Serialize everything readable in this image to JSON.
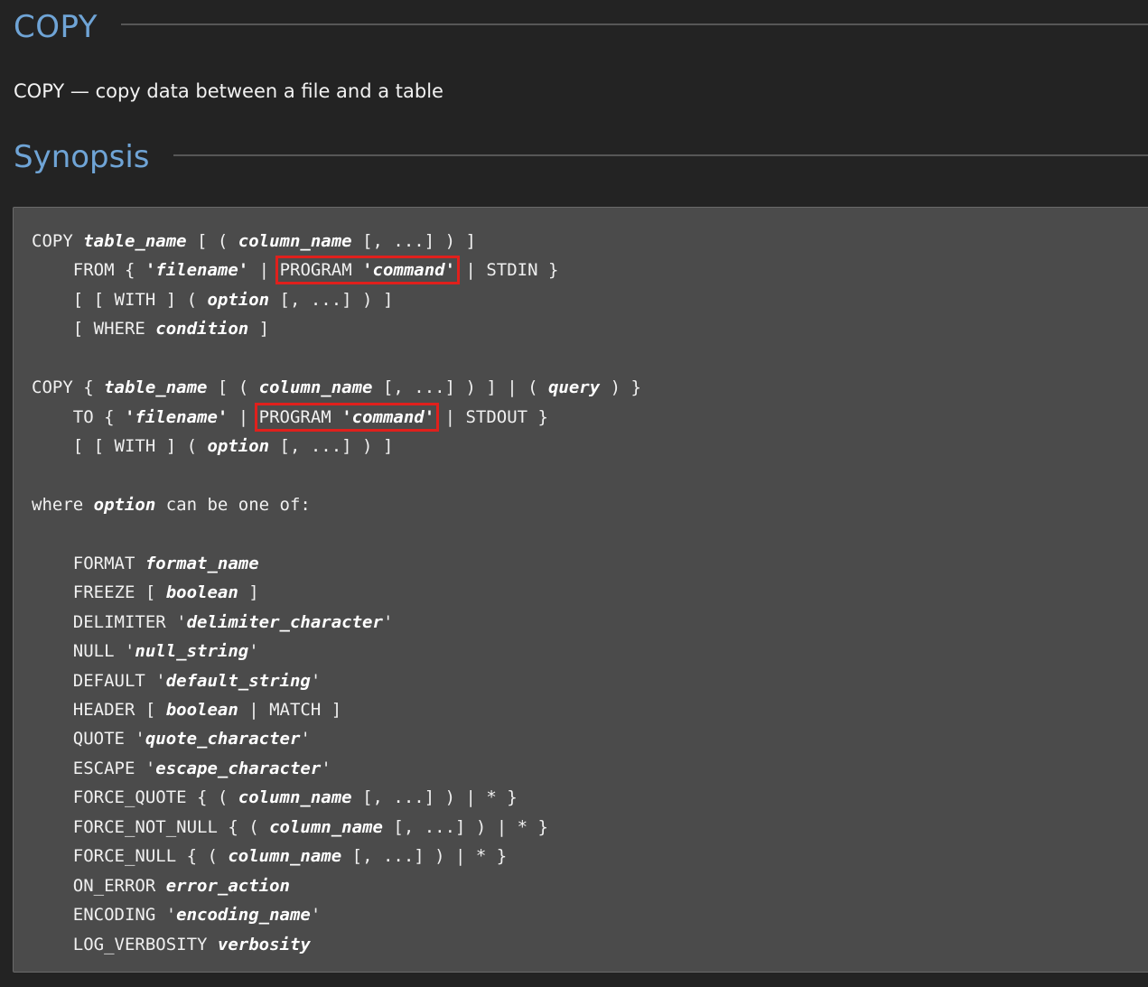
{
  "page": {
    "title": "COPY",
    "purpose": "COPY — copy data between a file and a table",
    "synopsis_heading": "Synopsis"
  },
  "highlight": {
    "box_color": "#e0201c"
  },
  "synopsis_lines": [
    [
      {
        "t": "COPY "
      },
      {
        "t": "table_name",
        "i": true
      },
      {
        "t": " [ ( "
      },
      {
        "t": "column_name",
        "i": true
      },
      {
        "t": " [, ...] ) ]"
      }
    ],
    [
      {
        "t": "    FROM { "
      },
      {
        "t": "'filename'",
        "i": true
      },
      {
        "t": " | "
      },
      {
        "hl": [
          {
            "t": "PROGRAM "
          },
          {
            "t": "'command'",
            "i": true
          }
        ]
      },
      {
        "t": " | STDIN }"
      }
    ],
    [
      {
        "t": "    [ [ WITH ] ( "
      },
      {
        "t": "option",
        "i": true
      },
      {
        "t": " [, ...] ) ]"
      }
    ],
    [
      {
        "t": "    [ WHERE "
      },
      {
        "t": "condition",
        "i": true
      },
      {
        "t": " ]"
      }
    ],
    [],
    [
      {
        "t": "COPY { "
      },
      {
        "t": "table_name",
        "i": true
      },
      {
        "t": " [ ( "
      },
      {
        "t": "column_name",
        "i": true
      },
      {
        "t": " [, ...] ) ] | ( "
      },
      {
        "t": "query",
        "i": true
      },
      {
        "t": " ) }"
      }
    ],
    [
      {
        "t": "    TO { "
      },
      {
        "t": "'filename'",
        "i": true
      },
      {
        "t": " | "
      },
      {
        "hl": [
          {
            "t": "PROGRAM "
          },
          {
            "t": "'command'",
            "i": true
          }
        ]
      },
      {
        "t": " | STDOUT }"
      }
    ],
    [
      {
        "t": "    [ [ WITH ] ( "
      },
      {
        "t": "option",
        "i": true
      },
      {
        "t": " [, ...] ) ]"
      }
    ],
    [],
    [
      {
        "t": "where "
      },
      {
        "t": "option",
        "i": true
      },
      {
        "t": " can be one of:"
      }
    ],
    [],
    [
      {
        "t": "    FORMAT "
      },
      {
        "t": "format_name",
        "i": true
      }
    ],
    [
      {
        "t": "    FREEZE [ "
      },
      {
        "t": "boolean",
        "i": true
      },
      {
        "t": " ]"
      }
    ],
    [
      {
        "t": "    DELIMITER '"
      },
      {
        "t": "delimiter_character",
        "i": true
      },
      {
        "t": "'"
      }
    ],
    [
      {
        "t": "    NULL '"
      },
      {
        "t": "null_string",
        "i": true
      },
      {
        "t": "'"
      }
    ],
    [
      {
        "t": "    DEFAULT '"
      },
      {
        "t": "default_string",
        "i": true
      },
      {
        "t": "'"
      }
    ],
    [
      {
        "t": "    HEADER [ "
      },
      {
        "t": "boolean",
        "i": true
      },
      {
        "t": " | MATCH ]"
      }
    ],
    [
      {
        "t": "    QUOTE '"
      },
      {
        "t": "quote_character",
        "i": true
      },
      {
        "t": "'"
      }
    ],
    [
      {
        "t": "    ESCAPE '"
      },
      {
        "t": "escape_character",
        "i": true
      },
      {
        "t": "'"
      }
    ],
    [
      {
        "t": "    FORCE_QUOTE { ( "
      },
      {
        "t": "column_name",
        "i": true
      },
      {
        "t": " [, ...] ) | * }"
      }
    ],
    [
      {
        "t": "    FORCE_NOT_NULL { ( "
      },
      {
        "t": "column_name",
        "i": true
      },
      {
        "t": " [, ...] ) | * }"
      }
    ],
    [
      {
        "t": "    FORCE_NULL { ( "
      },
      {
        "t": "column_name",
        "i": true
      },
      {
        "t": " [, ...] ) | * }"
      }
    ],
    [
      {
        "t": "    ON_ERROR "
      },
      {
        "t": "error_action",
        "i": true
      }
    ],
    [
      {
        "t": "    ENCODING '"
      },
      {
        "t": "encoding_name",
        "i": true
      },
      {
        "t": "'"
      }
    ],
    [
      {
        "t": "    LOG_VERBOSITY "
      },
      {
        "t": "verbosity",
        "i": true
      }
    ]
  ]
}
